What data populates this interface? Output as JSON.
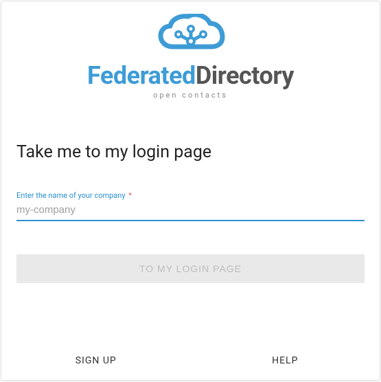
{
  "brand": {
    "word1": "Federated",
    "word2": "Directory",
    "tagline": "open contacts"
  },
  "page": {
    "title": "Take me to my login page"
  },
  "form": {
    "company_label": "Enter the name of your company",
    "required_mark": "*",
    "company_placeholder": "my-company",
    "submit_label": "TO MY LOGIN PAGE"
  },
  "footer": {
    "signup": "SIGN UP",
    "help": "HELP"
  }
}
